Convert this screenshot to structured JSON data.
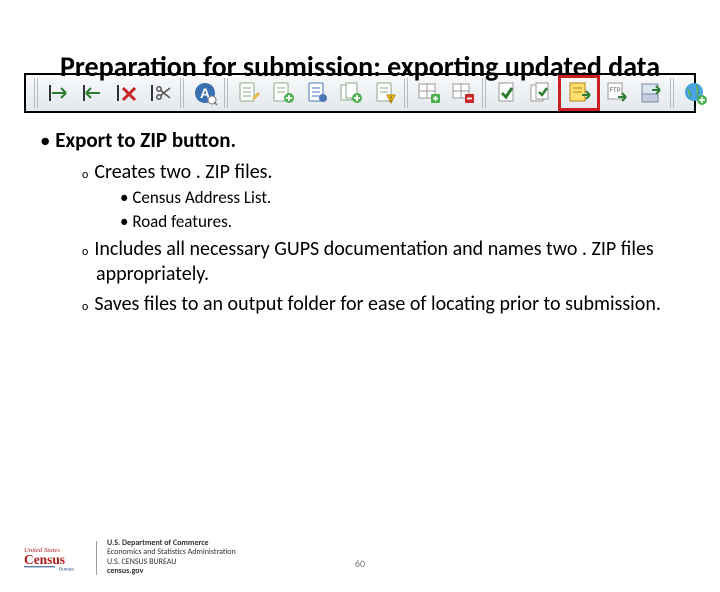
{
  "title": "Preparation for submission: exporting updated data",
  "toolbar": {
    "icons": [
      "insert-arrow-right-icon",
      "insert-arrow-left-icon",
      "delete-red-x-icon",
      "scissors-cut-icon",
      "find-address-a-icon",
      "form-pencil-icon",
      "form-plus-icon",
      "form-blue-icon",
      "multi-form-green-icon",
      "form-warning-icon",
      "grid-plus-icon",
      "grid-delete-icon",
      "doc-check-green-icon",
      "multi-doc-check-icon",
      "export-zip-yellow-icon",
      "ftp-arrow-icon",
      "disk-arrow-icon",
      "globe-plus-icon"
    ],
    "highlight_index": 14
  },
  "button_label": "Export to ZIP button.",
  "bullets": {
    "b1": "Creates two . ZIP files.",
    "b1_sub": [
      "Census Address List.",
      "Road features."
    ],
    "b2": "Includes all necessary GUPS documentation and names two . ZIP files appropriately.",
    "b3": "Saves files to an output folder for ease of locating prior to submission."
  },
  "footer": {
    "logo_main": "United States",
    "logo_sub": "Census",
    "logo_small": "Bureau",
    "dept_l1": "U.S. Department of Commerce",
    "dept_l2": "Economics and Statistics Administration",
    "dept_l3": "U.S. CENSUS BUREAU",
    "dept_l4": "census.gov"
  },
  "page_number": "60"
}
